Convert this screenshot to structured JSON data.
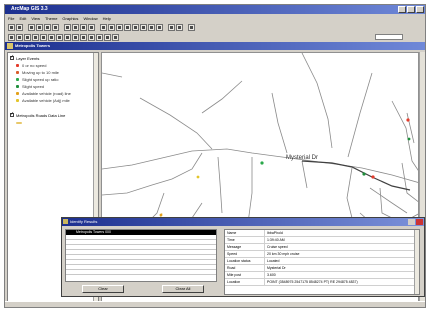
{
  "window": {
    "title": "ArcMap GIS 3.3"
  },
  "menus": [
    "File",
    "Edit",
    "View",
    "Theme",
    "Graphics",
    "Window",
    "Help"
  ],
  "document": {
    "title": "Metropolis Towers"
  },
  "toc": {
    "layers": [
      {
        "label": "Layer Events",
        "legend": [
          {
            "label": "0 or no speed",
            "color": "#e33b2b"
          },
          {
            "label": "Moving up to 10 mile",
            "color": "#d95c2a"
          },
          {
            "label": "Slight speed up ratio",
            "color": "#2aa84a"
          },
          {
            "label": "Slight speed",
            "color": "#1f8f3c"
          },
          {
            "label": "Available vehicle (road) line",
            "color": "#e3a11a"
          },
          {
            "label": "Available vehicle (Adj) mile",
            "color": "#e3c52a"
          }
        ]
      },
      {
        "label": "Metropolis Roads Data Line",
        "legend": [
          {
            "label": "",
            "color": "#e8c86a"
          }
        ]
      }
    ]
  },
  "map": {
    "street_label": "Mysterial Dr",
    "colors": {
      "roads": "#8a8a8a",
      "route": "#4a4a4a"
    }
  },
  "identify": {
    "title": "Identify Results",
    "list": {
      "selected": "Metropolis Towers 000"
    },
    "buttons": {
      "clear": "Clear",
      "clear_all": "Clear All"
    },
    "properties": [
      {
        "name": "Name",
        "value": "IbbaPhold"
      },
      {
        "name": "Time",
        "value": "1:39:40 AM"
      },
      {
        "name": "Message",
        "value": "Cruise speed"
      },
      {
        "name": "Speed",
        "value": "20 km 30 mph cruise"
      },
      {
        "name": "Location status",
        "value": "Located"
      },
      {
        "name": "Road",
        "value": "Mysterial Dr"
      },
      {
        "name": "Mile post",
        "value": "3.600"
      },
      {
        "name": "Location",
        "value": "POINT (3548975 2547175 8548274 PT) RE 294875 4837)"
      }
    ]
  }
}
